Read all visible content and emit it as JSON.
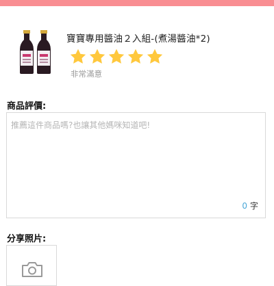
{
  "header": {
    "bar_color": "#f98e92"
  },
  "product": {
    "title": "寶寶專用醬油２入組-(煮湯醬油*2)",
    "thumbnail_icon": "soy-sauce-bottles-image",
    "rating_value": 5,
    "rating_max": 5,
    "rating_text": "非常滿意",
    "star_color": "#ffc83d"
  },
  "review": {
    "label": "商品評價:",
    "placeholder": "推薦這件商品嗎?也讓其他媽咪知道吧!",
    "value": "",
    "count": "0",
    "count_unit": "字",
    "count_color": "#4aa8d8"
  },
  "photos": {
    "label": "分享照片:",
    "upload_icon": "camera-icon"
  }
}
